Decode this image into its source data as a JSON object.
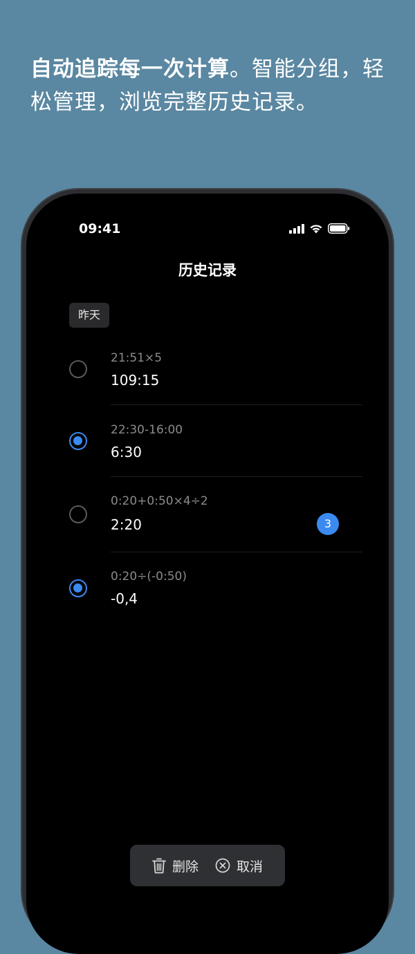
{
  "promo": {
    "headline_bold": "自动追踪每一次计算",
    "headline_rest": "。智能分组，轻松管理，浏览完整历史记录。"
  },
  "status_bar": {
    "time": "09:41",
    "icons": [
      "cellular-signal-icon",
      "wifi-icon",
      "battery-icon"
    ]
  },
  "nav": {
    "title": "历史记录"
  },
  "section": {
    "label": "昨天"
  },
  "history": [
    {
      "expression": "21:51×5",
      "result": "109:15",
      "selected": false,
      "badge": ""
    },
    {
      "expression": "22:30-16:00",
      "result": "6:30",
      "selected": true,
      "badge": ""
    },
    {
      "expression": "0:20+0:50×4÷2",
      "result": "2:20",
      "selected": false,
      "badge": "3"
    },
    {
      "expression": "0:20÷(-0:50)",
      "result": "-0,4",
      "selected": true,
      "badge": ""
    }
  ],
  "toolbar": {
    "delete_label": "删除",
    "cancel_label": "取消"
  },
  "colors": {
    "background": "#5a87a1",
    "accent": "#3b8af0",
    "screen": "#000000"
  }
}
